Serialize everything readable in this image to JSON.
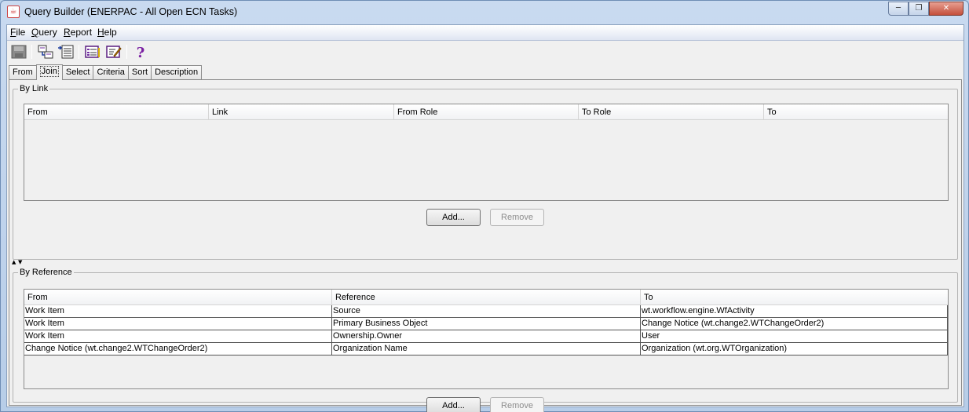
{
  "window": {
    "title": "Query Builder (ENERPAC - All Open ECN Tasks)"
  },
  "menu": [
    "File",
    "Query",
    "Report",
    "Help"
  ],
  "toolbar": [
    "save-icon",
    "join-icon",
    "select-icon",
    "list-icon",
    "edit-icon",
    "help-icon"
  ],
  "tabs": [
    "From",
    "Join",
    "Select",
    "Criteria",
    "Sort",
    "Description"
  ],
  "by_link": {
    "title": "By Link",
    "columns": [
      "From",
      "Link",
      "From Role",
      "To Role",
      "To"
    ],
    "add_label": "Add...",
    "remove_label": "Remove"
  },
  "by_reference": {
    "title": "By Reference",
    "columns": [
      "From",
      "Reference",
      "To"
    ],
    "rows": [
      [
        "Work Item",
        "Source",
        "wt.workflow.engine.WfActivity"
      ],
      [
        "Work Item",
        "Primary Business Object",
        "Change Notice (wt.change2.WTChangeOrder2)"
      ],
      [
        "Work Item",
        "Ownership.Owner",
        "User"
      ],
      [
        "Change Notice (wt.change2.WTChangeOrder2)",
        "Organization Name",
        "Organization (wt.org.WTOrganization)"
      ]
    ],
    "add_label": "Add...",
    "remove_label": "Remove"
  }
}
